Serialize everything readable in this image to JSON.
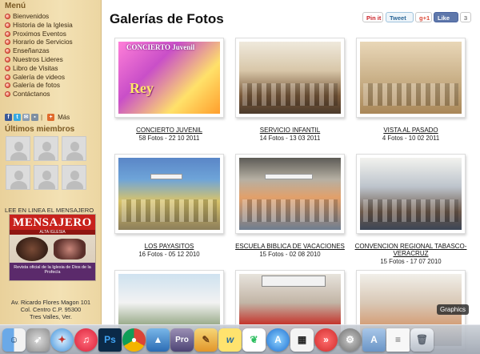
{
  "sidebar": {
    "menu_title": "Menú",
    "menu": [
      "Bienvenidos",
      "Historia de la Iglesia",
      "Proximos Eventos",
      "Horario de Servicios",
      "Enseñanzas",
      "Nuestros Lideres",
      "Libro de Visitas",
      "Galería de videos",
      "Galería de fotos",
      "Contáctanos"
    ],
    "social_more": "Más",
    "members_title": "Últimos miembros",
    "magazine_label": "LEE EN LINEA EL MENSAJERO",
    "magazine": {
      "title": "MENSAJERO",
      "subtitle": "ALTA IGLESIA",
      "footer": "Revista oficial de la Iglesia de Dios de la Profecía"
    },
    "address": [
      "Av. Ricardo  Flores Magon 101",
      "Col. Centro   C.P. 95300",
      "Tres Valles, Ver."
    ]
  },
  "main": {
    "page_title": "Galerías de Fotos",
    "share": {
      "pinterest": "Pin it",
      "tweet": "Tweet",
      "gplus": "g+1",
      "like": "Like",
      "like_count": "3"
    },
    "albums": [
      {
        "name": "CONCIERTO JUVENIL",
        "meta": "58 Fotos - 22 10 2011",
        "photo_text_1": "CONCIERTO Juvenil",
        "photo_text_2": "Rey"
      },
      {
        "name": "SERVICIO INFANTIL",
        "meta": "14 Fotos - 13 03 2011"
      },
      {
        "name": "VISTA AL PASADO",
        "meta": "4 Fotos - 10 02 2011"
      },
      {
        "name": "LOS PAYASITOS",
        "meta": "16 Fotos - 05 12 2010"
      },
      {
        "name": "ESCUELA BIBLICA DE VACACIONES",
        "meta": "15 Fotos - 02 08 2010"
      },
      {
        "name": "CONVENCION REGIONAL TABASCO-VERACRUZ",
        "meta": "15 Fotos - 17 07 2010"
      },
      {
        "name": "",
        "meta": ""
      },
      {
        "name": "",
        "meta": ""
      },
      {
        "name": "",
        "meta": ""
      }
    ]
  },
  "dock": {
    "tooltip": "Graphics",
    "items": [
      "finder-icon",
      "launchpad-icon",
      "safari-icon",
      "itunes-icon",
      "photoshop-icon",
      "chrome-icon",
      "keynote-icon",
      "pro-icon",
      "pages-icon",
      "wunderlist-icon",
      "evernote-icon",
      "app-store-icon",
      "calendar-icon",
      "screencast-icon",
      "system-preferences-icon",
      "applications-folder-icon",
      "document-icon",
      "trash-icon"
    ],
    "pro_label": "Pro",
    "ps_label": "Ps"
  }
}
